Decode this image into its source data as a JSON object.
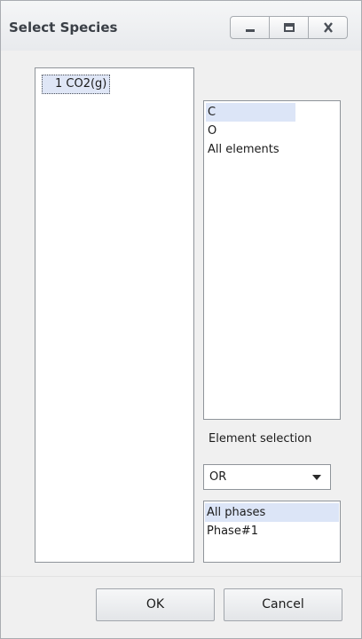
{
  "window": {
    "title": "Select Species"
  },
  "title_controls": {
    "minimize_icon": "minimize-icon",
    "maximize_icon": "maximize-icon",
    "close_icon": "close-icon"
  },
  "species": {
    "items": [
      {
        "label": "1 CO2(g)",
        "selected": true
      }
    ]
  },
  "elements": {
    "items": [
      {
        "label": "C",
        "selected": true
      },
      {
        "label": "O",
        "selected": false
      },
      {
        "label": "All elements",
        "selected": false
      }
    ]
  },
  "element_selection": {
    "label": "Element selection",
    "value": "OR"
  },
  "phases": {
    "items": [
      {
        "label": "All phases",
        "selected": true
      },
      {
        "label": "Phase#1",
        "selected": false
      }
    ]
  },
  "buttons": {
    "ok": "OK",
    "cancel": "Cancel"
  },
  "colors": {
    "selection": "#dce5f7",
    "border": "#8f949a",
    "window_bg": "#f0f0f0"
  }
}
